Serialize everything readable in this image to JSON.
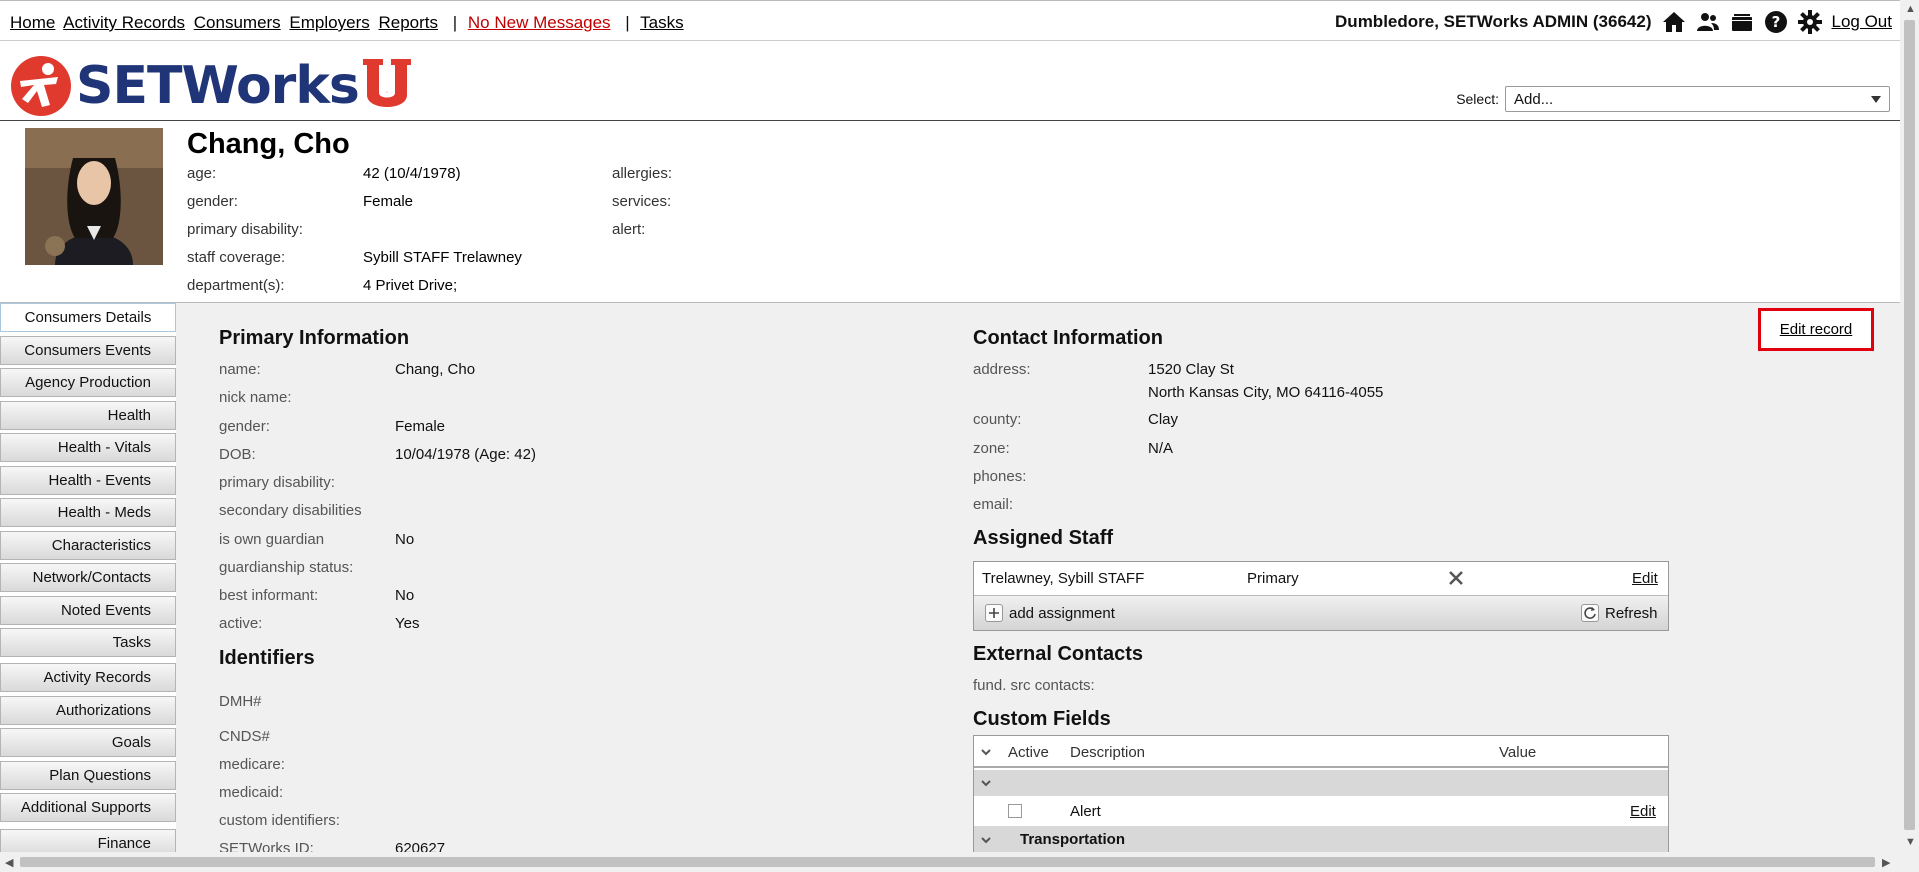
{
  "topnav": {
    "links": [
      "Home",
      "Activity Records",
      "Consumers",
      "Employers",
      "Reports"
    ],
    "messages": "No New Messages",
    "tasks": "Tasks",
    "user": "Dumbledore, SETWorks ADMIN  (36642)",
    "logout": "Log Out",
    "icons": [
      "home-icon",
      "users-icon",
      "folder-icon",
      "help-icon",
      "gear-icon"
    ]
  },
  "logo": {
    "word": "SETWorks",
    "letter": "U"
  },
  "select": {
    "label": "Select:",
    "value": "Add..."
  },
  "consumer": {
    "name": "Chang, Cho",
    "fields": {
      "age_label": "age:",
      "age": "42 (10/4/1978)",
      "gender_label": "gender:",
      "gender": "Female",
      "disability_label": "primary disability:",
      "disability": "",
      "staff_label": "staff coverage:",
      "staff": "Sybill STAFF Trelawney",
      "dept_label": "department(s):",
      "dept": "4 Privet Drive;",
      "allergies_label": "allergies:",
      "services_label": "services:",
      "alert_label": "alert:"
    }
  },
  "leftnav": {
    "items": [
      "Consumers Details",
      "Consumers Events",
      "Agency Production",
      "Health",
      "Health - Vitals",
      "Health - Events",
      "Health - Meds",
      "Characteristics",
      "Network/Contacts",
      "Noted Events",
      "Tasks",
      "Activity Records",
      "Authorizations",
      "Goals",
      "Plan Questions",
      "Additional Supports",
      "Finance"
    ]
  },
  "edit_record": "Edit record",
  "primary": {
    "title": "Primary Information",
    "rows": [
      {
        "label": "name:",
        "value": "Chang, Cho"
      },
      {
        "label": "nick name:",
        "value": ""
      },
      {
        "label": "gender:",
        "value": "Female"
      },
      {
        "label": "DOB:",
        "value": "10/04/1978 (Age: 42)"
      },
      {
        "label": "primary disability:",
        "value": ""
      },
      {
        "label": "secondary disabilities",
        "value": ""
      },
      {
        "label": "is own guardian",
        "value": "No"
      },
      {
        "label": "guardianship status:",
        "value": ""
      },
      {
        "label": "best informant:",
        "value": "No"
      },
      {
        "label": "active:",
        "value": "Yes"
      }
    ]
  },
  "identifiers": {
    "title": "Identifiers",
    "rows": [
      {
        "label": "DMH#",
        "value": ""
      },
      {
        "label": "CNDS#",
        "value": ""
      },
      {
        "label": "medicare:",
        "value": ""
      },
      {
        "label": "medicaid:",
        "value": ""
      },
      {
        "label": "custom identifiers:",
        "value": ""
      },
      {
        "label": "SETWorks ID:",
        "value": "620627"
      }
    ]
  },
  "contact": {
    "title": "Contact Information",
    "address_label": "address:",
    "address1": "1520 Clay St",
    "address2": "North Kansas City, MO 64116-4055",
    "county_label": "county:",
    "county": "Clay",
    "zone_label": "zone:",
    "zone": "N/A",
    "phones_label": "phones:",
    "email_label": "email:"
  },
  "staff": {
    "title": "Assigned Staff",
    "name": "Trelawney, Sybill STAFF",
    "role": "Primary",
    "edit": "Edit",
    "add": "add assignment",
    "refresh": "Refresh"
  },
  "external": {
    "title": "External Contacts",
    "label": "fund. src contacts:"
  },
  "custom": {
    "title": "Custom Fields",
    "col_active": "Active",
    "col_description": "Description",
    "col_value": "Value",
    "row_desc": "Alert",
    "row_edit": "Edit",
    "group2": "Transportation"
  },
  "colors": {
    "brand_blue": "#1f3577",
    "brand_red": "#e03a2f",
    "highlight": "#e0000f"
  }
}
